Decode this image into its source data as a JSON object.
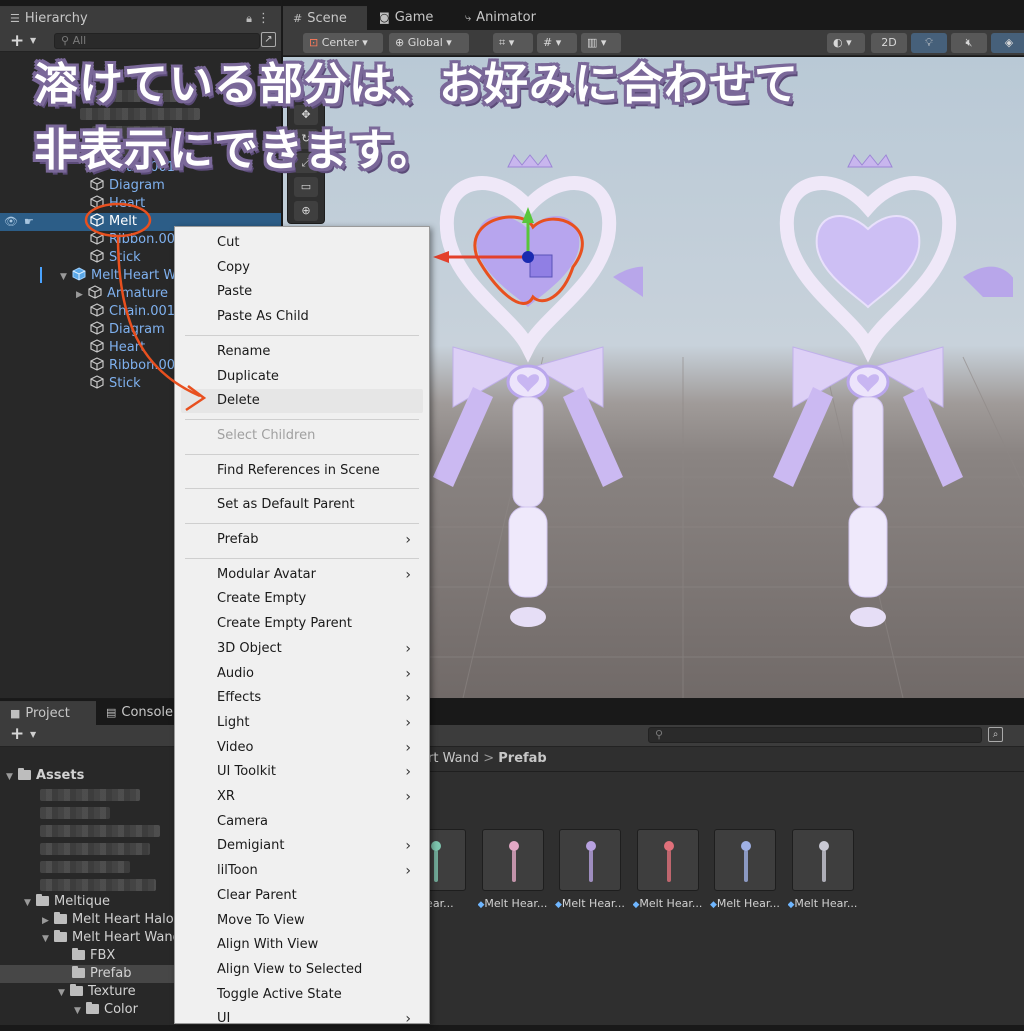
{
  "hierarchy": {
    "tab_label": "Hierarchy",
    "search_placeholder": "All",
    "rows": [
      {
        "label": "Chain.001"
      },
      {
        "label": "Diagram"
      },
      {
        "label": "Heart"
      },
      {
        "label": "Melt"
      },
      {
        "label": "Ribbon.001"
      },
      {
        "label": "Stick"
      },
      {
        "label": "Melt Heart Wand"
      },
      {
        "label": "Armature"
      },
      {
        "label": "Chain.001"
      },
      {
        "label": "Diagram"
      },
      {
        "label": "Heart"
      },
      {
        "label": "Ribbon.001"
      },
      {
        "label": "Stick"
      }
    ]
  },
  "scene": {
    "tabs": [
      {
        "label": "Scene",
        "icon": "hash-icon"
      },
      {
        "label": "Game",
        "icon": "gamepad-icon"
      },
      {
        "label": "Animator",
        "icon": "animator-icon"
      }
    ],
    "toolbar": {
      "pivot": "Center",
      "space": "Global",
      "mode_2d": "2D"
    }
  },
  "context_menu": {
    "items": [
      {
        "label": "Cut"
      },
      {
        "label": "Copy"
      },
      {
        "label": "Paste"
      },
      {
        "label": "Paste As Child"
      },
      {
        "label": "Rename"
      },
      {
        "label": "Duplicate"
      },
      {
        "label": "Delete",
        "hover": true
      },
      {
        "label": "Select Children",
        "disabled": true
      },
      {
        "label": "Find References in Scene"
      },
      {
        "label": "Set as Default Parent"
      },
      {
        "label": "Prefab",
        "submenu": true
      },
      {
        "label": "Modular Avatar",
        "submenu": true
      },
      {
        "label": "Create Empty"
      },
      {
        "label": "Create Empty Parent"
      },
      {
        "label": "3D Object",
        "submenu": true
      },
      {
        "label": "Audio",
        "submenu": true
      },
      {
        "label": "Effects",
        "submenu": true
      },
      {
        "label": "Light",
        "submenu": true
      },
      {
        "label": "Video",
        "submenu": true
      },
      {
        "label": "UI Toolkit",
        "submenu": true
      },
      {
        "label": "XR",
        "submenu": true
      },
      {
        "label": "Camera"
      },
      {
        "label": "Demigiant",
        "submenu": true
      },
      {
        "label": "lilToon",
        "submenu": true
      },
      {
        "label": "Clear Parent"
      },
      {
        "label": "Move To View"
      },
      {
        "label": "Align With View"
      },
      {
        "label": "Align View to Selected"
      },
      {
        "label": "Toggle Active State"
      },
      {
        "label": "UI",
        "submenu": true
      }
    ],
    "arrow_glyph": "›"
  },
  "project": {
    "tabs": [
      {
        "label": "Project"
      },
      {
        "label": "Console"
      }
    ],
    "breadcrumb": {
      "parent": "rt Wand",
      "separator": ">",
      "current": "Prefab"
    },
    "folders": [
      {
        "label": "Assets"
      },
      {
        "label": "Meltique"
      },
      {
        "label": "Melt Heart Halo"
      },
      {
        "label": "Melt Heart Wand"
      },
      {
        "label": "FBX"
      },
      {
        "label": "Prefab"
      },
      {
        "label": "Texture"
      },
      {
        "label": "Color"
      }
    ],
    "assets": [
      {
        "label": "lt Hear...",
        "color": "#7fc7b0"
      },
      {
        "label": "Melt Hear...",
        "color": "#e3a9c6"
      },
      {
        "label": "Melt Hear...",
        "color": "#b7a1e0"
      },
      {
        "label": "Melt Hear...",
        "color": "#e0707a"
      },
      {
        "label": "Melt Hear...",
        "color": "#9fb0e4"
      },
      {
        "label": "Melt Hear...",
        "color": "#c9c9d4"
      }
    ]
  },
  "caption": {
    "line1": "溶けている部分は、お好みに合わせて",
    "line2": "非表示にできます。"
  },
  "colors": {
    "selection": "#2c5d87",
    "annotation": "#e8501f",
    "caption_outline": "#7a6899"
  }
}
